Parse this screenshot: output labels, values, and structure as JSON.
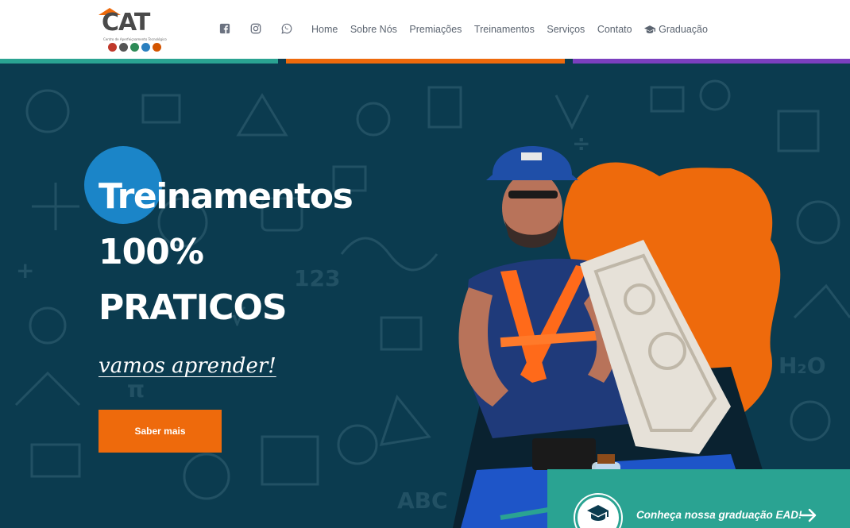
{
  "brand": {
    "logo_text": "CAT",
    "logo_subtitle": "Centro de Aperfeiçoamento Tecnológico",
    "colors": {
      "orange": "#ee6a0c",
      "teal": "#2aa392",
      "purple": "#7b3fbf",
      "navy": "#0b3b4f",
      "blue": "#1b85c8"
    }
  },
  "social": [
    {
      "icon": "facebook-icon"
    },
    {
      "icon": "instagram-icon"
    },
    {
      "icon": "whatsapp-icon"
    }
  ],
  "nav": {
    "home": "Home",
    "sobre": "Sobre Nós",
    "premiacoes": "Premiações",
    "treinamentos": "Treinamentos",
    "servicos": "Serviços",
    "contato": "Contato",
    "graduacao": "Graduação",
    "graduacao_icon": "graduation-cap-icon"
  },
  "hero": {
    "line1": "Treinamentos",
    "line2": "100%",
    "line3": "PRATICOS",
    "script": "vamos aprender!",
    "cta_label": "Saber mais"
  },
  "ead": {
    "text": "Conheça nossa graduação EAD!",
    "icon": "graduation-cap-icon",
    "arrow_icon": "arrow-right-icon"
  }
}
